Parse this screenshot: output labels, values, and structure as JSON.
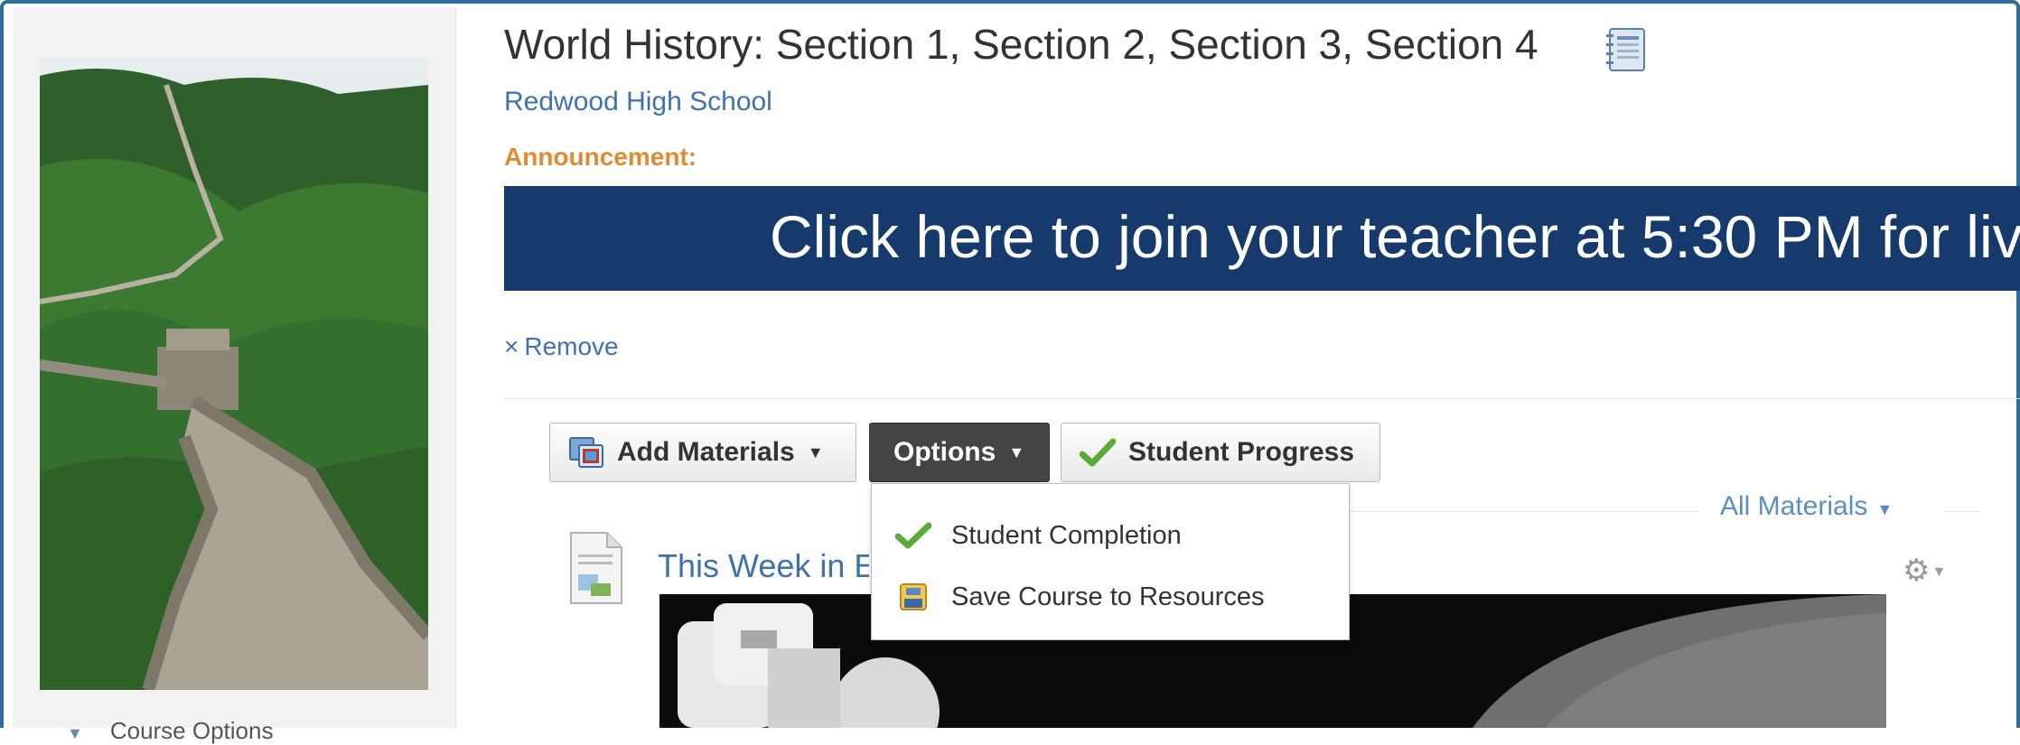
{
  "course": {
    "title": "World History: Section 1, Section 2, Section 3, Section 4",
    "school": "Redwood High School",
    "announcement_label": "Announcement:",
    "banner_text": "Click here to join your teacher at 5:30 PM for liv",
    "remove_label": "Remove",
    "remove_icon": "×"
  },
  "sidebar": {
    "course_options_label": "Course Options"
  },
  "toolbar": {
    "add_materials_label": "Add Materials",
    "options_label": "Options",
    "student_progress_label": "Student Progress"
  },
  "options_menu": {
    "items": [
      {
        "label": "Student Completion",
        "icon": "check-icon"
      },
      {
        "label": "Save Course to Resources",
        "icon": "save-icon"
      }
    ]
  },
  "materials": {
    "filter_label": "All Materials",
    "items": [
      {
        "title": "This Week in E",
        "icon": "document-icon"
      }
    ]
  },
  "colors": {
    "banner_bg": "#163a6b",
    "link": "#3f72ad",
    "announcement": "#e08a32",
    "options_button": "#444444",
    "check_green": "#5aab3a",
    "frame_border": "#2f6d9c"
  }
}
